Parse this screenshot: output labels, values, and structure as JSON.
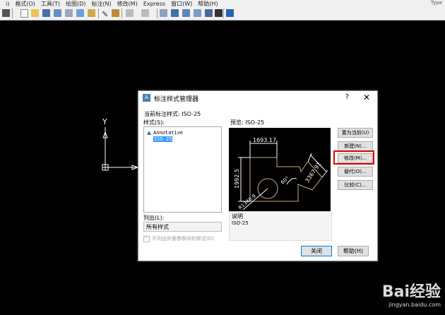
{
  "menubar": {
    "items": [
      "i)",
      "格式(O)",
      "工具(T)",
      "绘图(D)",
      "标注(N)",
      "修改(M)",
      "Express",
      "窗口(W)",
      "帮助(H)"
    ],
    "type_hint": "Type"
  },
  "ucs": {
    "y_label": "Y"
  },
  "dialog": {
    "icon_text": "A",
    "title": "标注样式管理器",
    "help": "?",
    "close": "✕",
    "current_style_label": "当前标注样式: ISO-25",
    "styles_label": "样式(S):",
    "styles": [
      "Annotative",
      "ISO-25"
    ],
    "preview_label": "预览: ISO-25",
    "list_label": "列出(L):",
    "list_value": "所有样式",
    "exclude_xref_label": "不列出外部参照中的样式(D)",
    "desc_label": "说明",
    "desc_value": "ISO-25",
    "buttons": {
      "set_current": "置为当前(U)",
      "new": "新建(N)...",
      "modify": "修改(M)...",
      "override": "替代(O)...",
      "compare": "比较(C)...",
      "close": "关闭",
      "help": "帮助(H)"
    },
    "preview_dims": {
      "top": "1693.17",
      "left": "1992.5",
      "right": "3367.91",
      "angle": "60°",
      "radius": "R1340.9"
    }
  },
  "watermark": {
    "brand": "Bai经验",
    "url": "jingyan.baidu.com"
  }
}
